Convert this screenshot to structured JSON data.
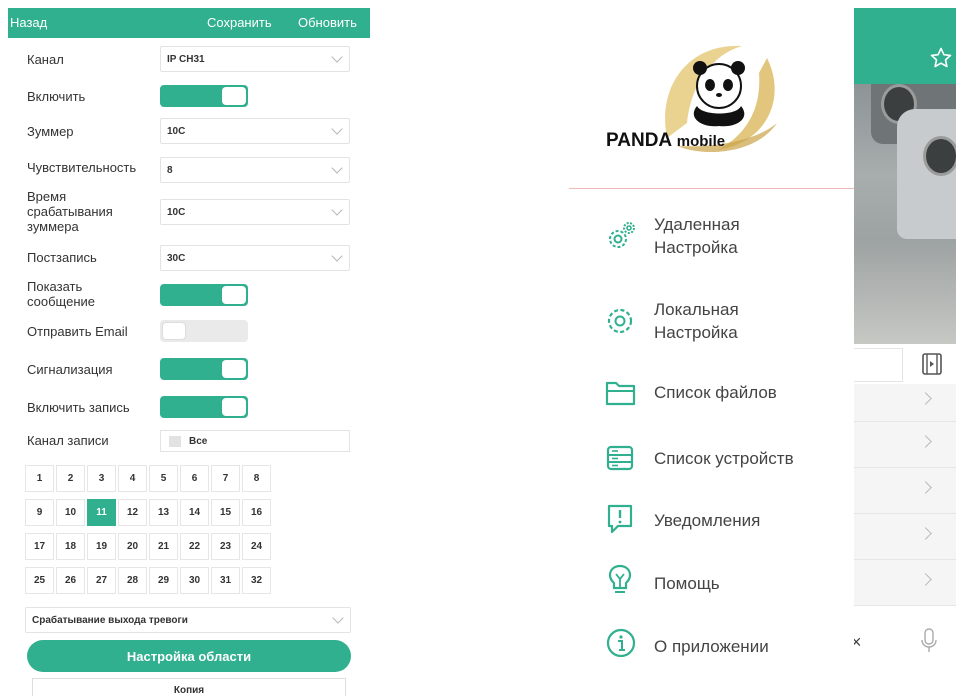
{
  "settings": {
    "topbar": {
      "back": "Назад",
      "save": "Сохранить",
      "refresh": "Обновить"
    },
    "channel": {
      "label": "Канал",
      "value": "IP CH31"
    },
    "enable": {
      "label": "Включить",
      "on": true
    },
    "buzzer": {
      "label": "Зуммер",
      "value": "10С"
    },
    "sensitivity": {
      "label": "Чувствительность",
      "value": "8"
    },
    "buzzer_time": {
      "label_lines": [
        "Время",
        "срабатывания",
        "зуммера"
      ],
      "value": "10С"
    },
    "post_record": {
      "label": "Постзапись",
      "value": "30С"
    },
    "show_message": {
      "label_lines": [
        "Показать",
        "сообщение"
      ],
      "on": true
    },
    "send_email": {
      "label": "Отправить Email",
      "on": false
    },
    "alarm": {
      "label": "Сигнализация",
      "on": true
    },
    "enable_record": {
      "label": "Включить запись",
      "on": true
    },
    "record_channel": {
      "label": "Канал записи",
      "checkbox_label": "Все"
    },
    "channels": [
      "1",
      "2",
      "3",
      "4",
      "5",
      "6",
      "7",
      "8",
      "9",
      "10",
      "11",
      "12",
      "13",
      "14",
      "15",
      "16",
      "17",
      "18",
      "19",
      "20",
      "21",
      "22",
      "23",
      "24",
      "25",
      "26",
      "27",
      "28",
      "29",
      "30",
      "31",
      "32"
    ],
    "selected_channel": "11",
    "alarm_output": {
      "value": "Срабатывание выхода тревоги"
    },
    "area_button": "Настройка области",
    "copy_button": "Копия"
  },
  "drawer": {
    "logo": {
      "brand": "PANDA",
      "suffix": "mobile"
    },
    "menu": [
      {
        "label_lines": [
          "Удаленная",
          "Настройка"
        ],
        "icon": "gears-icon"
      },
      {
        "label_lines": [
          "Локальная",
          "Настройка"
        ],
        "icon": "gear-icon"
      },
      {
        "label_lines": [
          "Список файлов"
        ],
        "icon": "folder-icon"
      },
      {
        "label_lines": [
          "Список устройств"
        ],
        "icon": "server-icon"
      },
      {
        "label_lines": [
          "Уведомления"
        ],
        "icon": "notification-icon"
      },
      {
        "label_lines": [
          "Помощь"
        ],
        "icon": "help-bulb-icon"
      },
      {
        "label_lines": [
          "О приложении"
        ],
        "icon": "info-icon"
      }
    ]
  },
  "background": {
    "close_glyph": "×"
  },
  "colors": {
    "accent": "#30b08f",
    "divider": "#f0b9b9"
  }
}
